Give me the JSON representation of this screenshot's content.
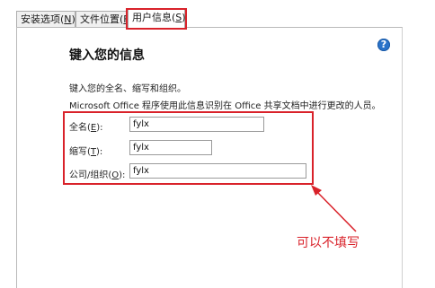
{
  "tabs": [
    {
      "text": "安装选项(",
      "key": "N",
      "suffix": ")"
    },
    {
      "text": "文件位置(",
      "key": "F",
      "suffix": ")"
    },
    {
      "text": "用户信息(",
      "key": "S",
      "suffix": ")"
    }
  ],
  "panel": {
    "help_icon_glyph": "?",
    "title": "键入您的信息",
    "instruction": "键入您的全名、缩写和组织。",
    "description": "Microsoft Office 程序使用此信息识别在 Office 共享文档中进行更改的人员。"
  },
  "fields": {
    "full_name": {
      "label": "全名(",
      "key": "E",
      "suffix": "):",
      "value": "fylx"
    },
    "initials": {
      "label": "缩写(",
      "key": "T",
      "suffix": "):",
      "value": "fylx"
    },
    "organization": {
      "label": "公司/组织(",
      "key": "O",
      "suffix": "):",
      "value": "fylx"
    }
  },
  "annotation": {
    "text": "可以不填写",
    "color": "#d9222a"
  },
  "colors": {
    "highlight": "#d9222a",
    "help_icon": "#2a73c9"
  }
}
